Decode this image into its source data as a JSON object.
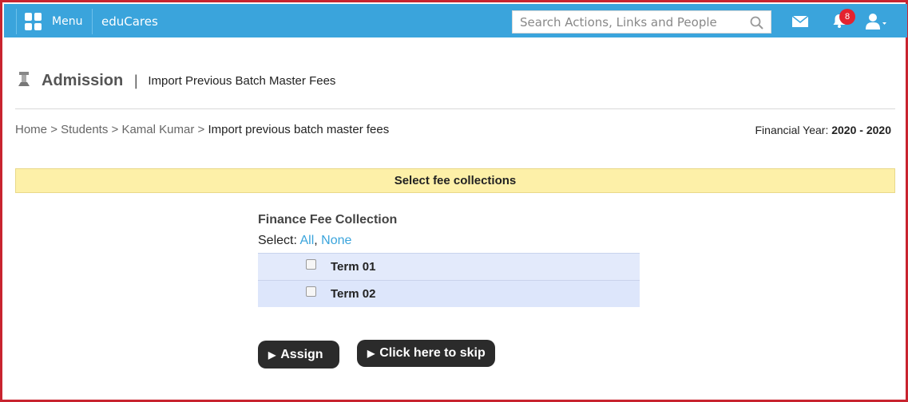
{
  "topbar": {
    "menu_label": "Menu",
    "brand": "eduCares",
    "search_placeholder": "Search Actions, Links and People",
    "notification_count": "8",
    "icons": [
      "grid-icon",
      "search-icon",
      "mail-icon",
      "bell-icon",
      "user-icon"
    ],
    "bar_color": "#3aa4dc"
  },
  "header": {
    "title": "Admission",
    "separator": "|",
    "subtitle": "Import Previous Batch Master Fees"
  },
  "breadcrumb": {
    "items": [
      "Home",
      "Students",
      "Kamal Kumar"
    ],
    "separator": ">",
    "current": "Import previous batch master fees"
  },
  "financial_year": {
    "label": "Financial Year:",
    "start": "2020",
    "dash": "-",
    "end": "2020"
  },
  "banner": {
    "text": "Select fee collections",
    "color": "#fdf0a8"
  },
  "fee_collection": {
    "title": "Finance Fee Collection",
    "select_label": "Select:",
    "select_all": "All",
    "comma": ",",
    "select_none": "None",
    "terms": [
      {
        "label": "Term 01",
        "checked": false
      },
      {
        "label": "Term 02",
        "checked": false
      }
    ]
  },
  "actions": {
    "assign_label": "Assign",
    "skip_label": "Click here to skip"
  }
}
